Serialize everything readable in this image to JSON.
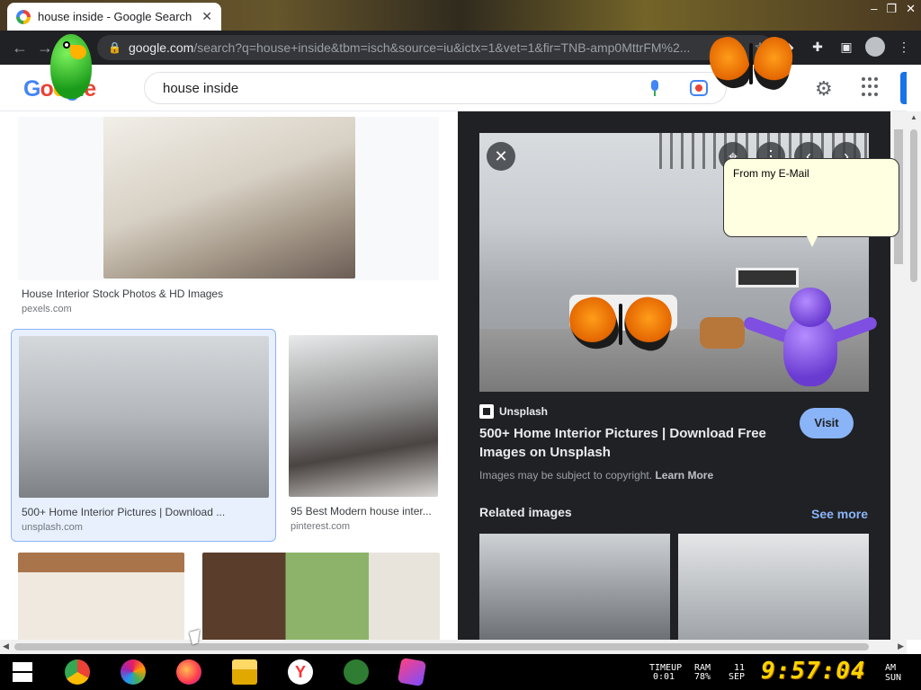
{
  "browser": {
    "tab_title": "house inside - Google Search",
    "tab_close": "✕",
    "url_host": "google.com",
    "url_path": "/search?q=house+inside&tbm=isch&source=iu&ictx=1&vet=1&fir=TNB-amp0MttrFM%2..."
  },
  "google": {
    "logo": [
      "G",
      "o",
      "o",
      "g",
      "l",
      "e"
    ],
    "query": "house inside"
  },
  "results": [
    {
      "caption": "House Interior Stock Photos & HD Images",
      "source": "pexels.com"
    },
    {
      "caption": "500+ Home Interior Pictures | Download ...",
      "source": "unsplash.com",
      "selected": true
    },
    {
      "caption": "95 Best Modern house inter...",
      "source": "pinterest.com"
    }
  ],
  "preview": {
    "source": "Unsplash",
    "title": "500+ Home Interior Pictures | Download Free Images on Unsplash",
    "visit": "Visit",
    "copyright_text": "Images may be subject to copyright.",
    "learn_more": "Learn More",
    "related_heading": "Related images",
    "see_more": "See more"
  },
  "overlay": {
    "bubble_text": "From my E-Mail"
  },
  "taskbar": {
    "timeup_label": "TIMEUP",
    "timeup_value": "0:01",
    "ram_label": "RAM",
    "ram_value": "78%",
    "date_day": "11",
    "date_month": "SEP",
    "clock": "9:57:04",
    "ampm": "AM",
    "weekday": "SUN"
  },
  "colors": {
    "accent_blue": "#1a73e8",
    "preview_bg": "#202124",
    "visit_button": "#8ab4f8",
    "clock_yellow": "#ffd400"
  }
}
